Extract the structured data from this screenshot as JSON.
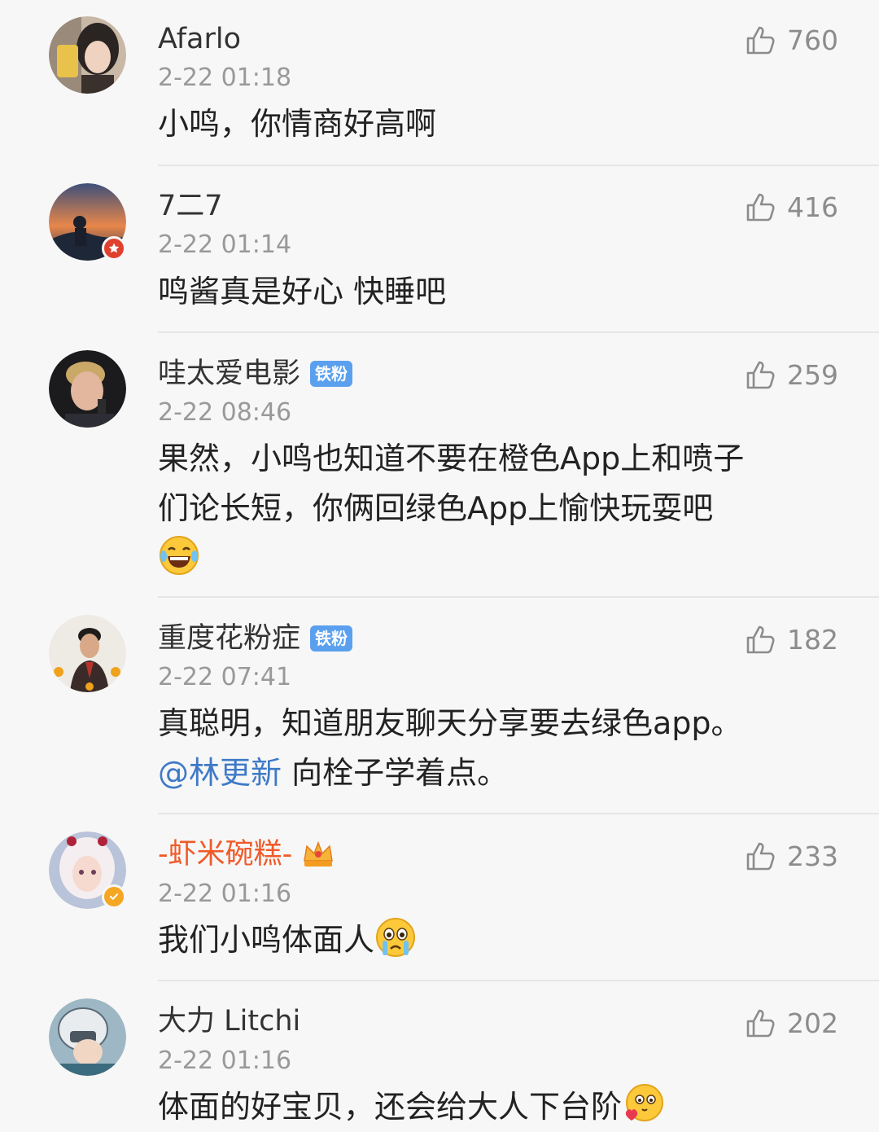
{
  "comments": [
    {
      "username": "Afarlo",
      "timestamp": "2-22 01:18",
      "likes": "760",
      "text": "小鸣，你情商好高啊"
    },
    {
      "username": "7二7",
      "timestamp": "2-22 01:14",
      "likes": "416",
      "text": "鸣酱真是好心 快睡吧"
    },
    {
      "username": "哇太爱电影",
      "badge": "铁粉",
      "timestamp": "2-22 08:46",
      "likes": "259",
      "text_line1": "果然，小鸣也知道不要在橙色App上和喷子",
      "text_line2": "们论长短，你俩回绿色App上愉快玩耍吧",
      "emoji": "laughing-tears-emoji"
    },
    {
      "username": "重度花粉症",
      "badge": "铁粉",
      "timestamp": "2-22 07:41",
      "likes": "182",
      "text_line1": "真聪明，知道朋友聊天分享要去绿色app。",
      "mention": "@林更新",
      "text_line2_rest": " 向栓子学着点。"
    },
    {
      "username": "-虾米碗糕-",
      "username_color": "#f05a28",
      "timestamp": "2-22 01:16",
      "likes": "233",
      "text": "我们小鸣体面人",
      "emoji": "crying-emoji",
      "crown": "crown-icon"
    },
    {
      "username": "大力 Litchi",
      "timestamp": "2-22 01:16",
      "likes": "202",
      "text": "体面的好宝贝，还会给大人下台阶",
      "emoji": "shy-heart-emoji"
    }
  ],
  "colors": {
    "background": "#f7f7f7",
    "fan_badge": "#5aa0ee",
    "mention": "#3e79c7",
    "vip_orange": "#f05a28"
  }
}
